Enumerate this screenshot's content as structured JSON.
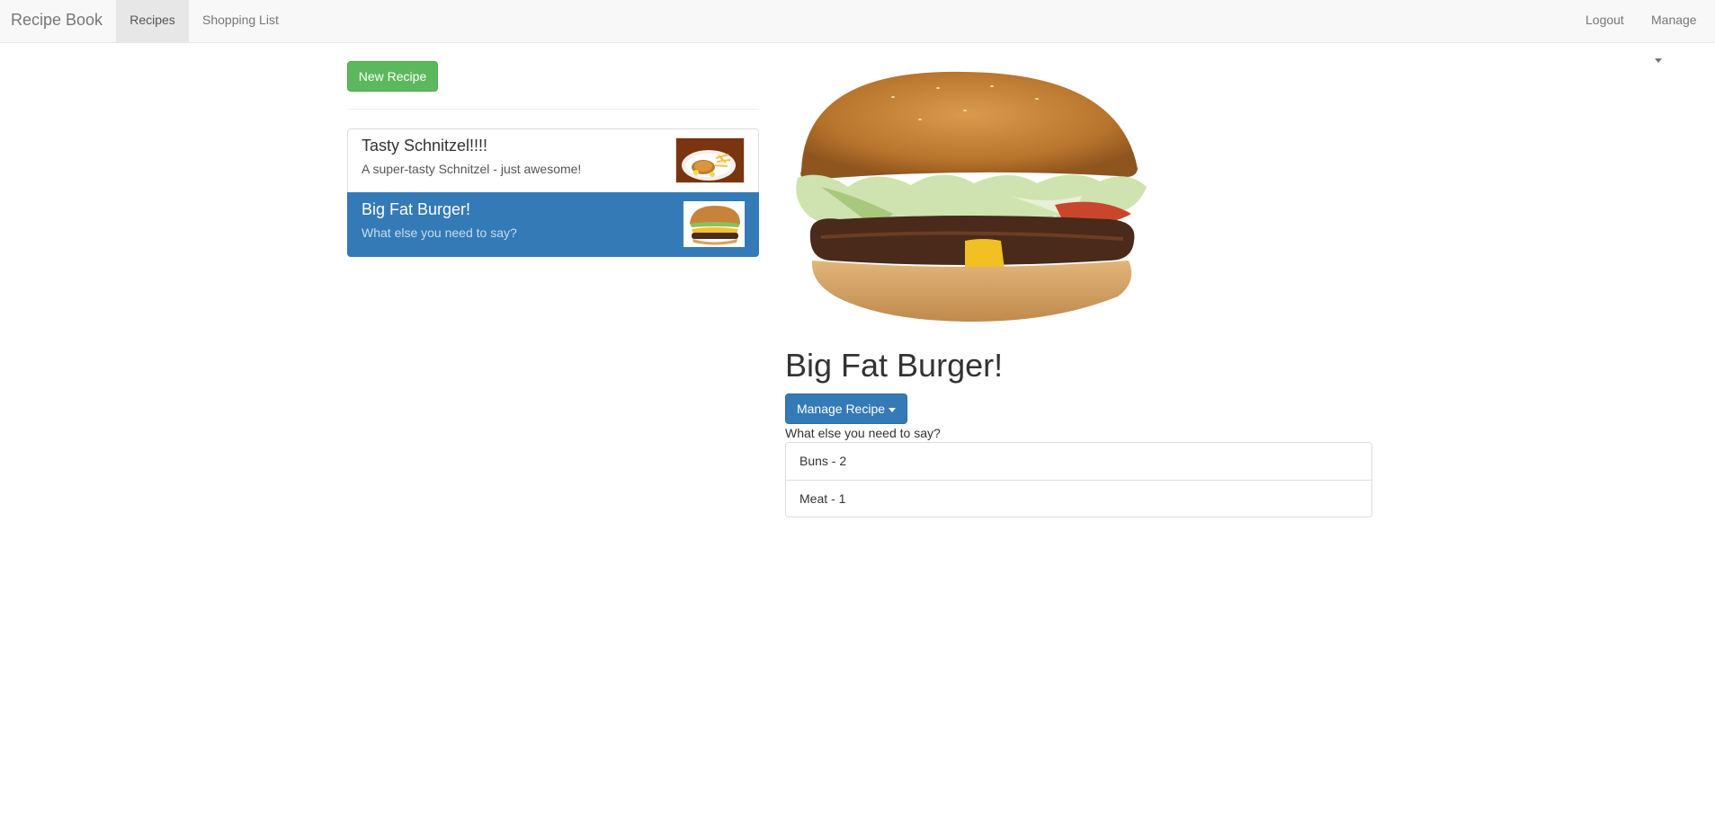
{
  "navbar": {
    "brand": "Recipe Book",
    "links": [
      {
        "label": "Recipes",
        "active": true
      },
      {
        "label": "Shopping List",
        "active": false
      }
    ],
    "right": {
      "logout_label": "Logout",
      "manage_label": "Manage"
    }
  },
  "sidebar": {
    "new_recipe_label": "New Recipe",
    "recipes": [
      {
        "name": "Tasty Schnitzel!!!!",
        "description": "A super-tasty Schnitzel - just awesome!",
        "image": "schnitzel-thumbnail",
        "selected": false
      },
      {
        "name": "Big Fat Burger!",
        "description": "What else you need to say?",
        "image": "burger-thumbnail",
        "selected": true
      }
    ]
  },
  "detail": {
    "image": "burger-image",
    "title": "Big Fat Burger!",
    "manage_label": "Manage Recipe",
    "description": "What else you need to say?",
    "ingredients": [
      {
        "text": "Buns - 2"
      },
      {
        "text": "Meat - 1"
      }
    ]
  },
  "colors": {
    "primary": "#337ab7",
    "success": "#5cb85c",
    "navbar_bg": "#f8f8f8"
  }
}
